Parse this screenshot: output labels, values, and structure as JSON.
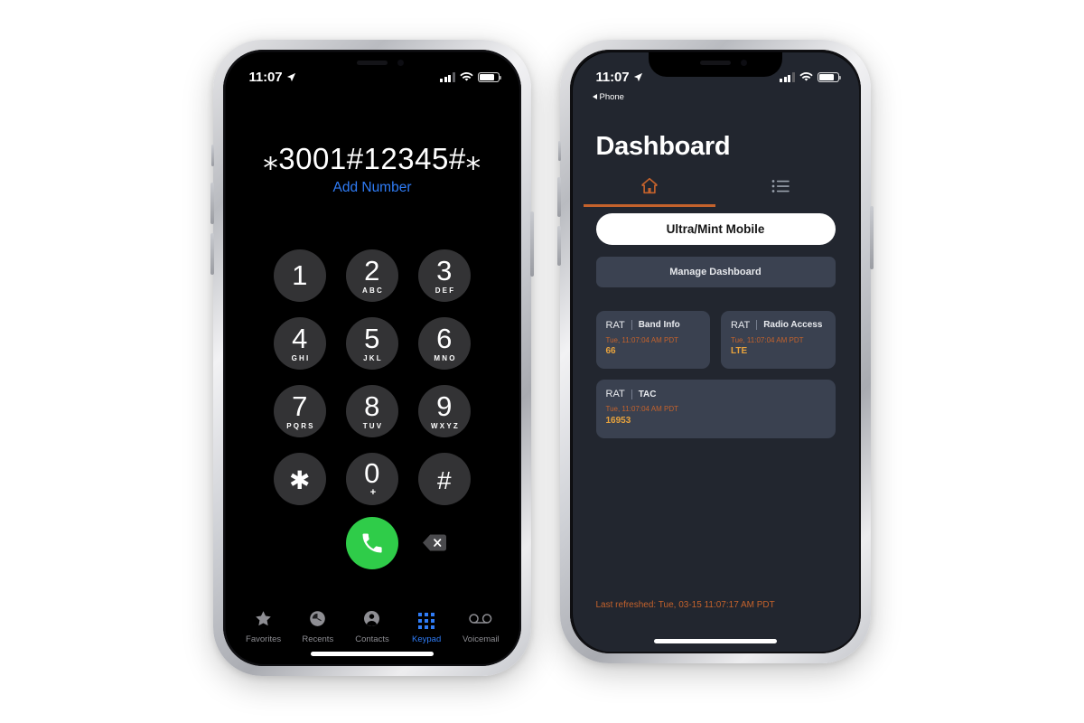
{
  "left_phone": {
    "status_bar": {
      "time": "11:07",
      "location_icon": "location-arrow-icon",
      "signal_icon": "cellular-signal-icon",
      "wifi_icon": "wifi-icon",
      "battery_icon": "battery-icon"
    },
    "dialer": {
      "number": "⁎3001#12345#⁎",
      "add_number_label": "Add Number",
      "keys": [
        {
          "digit": "1",
          "letters": ""
        },
        {
          "digit": "2",
          "letters": "ABC"
        },
        {
          "digit": "3",
          "letters": "DEF"
        },
        {
          "digit": "4",
          "letters": "GHI"
        },
        {
          "digit": "5",
          "letters": "JKL"
        },
        {
          "digit": "6",
          "letters": "MNO"
        },
        {
          "digit": "7",
          "letters": "PQRS"
        },
        {
          "digit": "8",
          "letters": "TUV"
        },
        {
          "digit": "9",
          "letters": "WXYZ"
        },
        {
          "digit": "✱",
          "letters": ""
        },
        {
          "digit": "0",
          "letters": "+"
        },
        {
          "digit": "#",
          "letters": ""
        }
      ],
      "call_button_icon": "phone-handset-icon",
      "delete_button_icon": "backspace-icon",
      "call_button_color": "#2fcc49"
    },
    "tabs": [
      {
        "label": "Favorites",
        "icon": "star-icon",
        "active": false
      },
      {
        "label": "Recents",
        "icon": "clock-icon",
        "active": false
      },
      {
        "label": "Contacts",
        "icon": "person-circle-icon",
        "active": false
      },
      {
        "label": "Keypad",
        "icon": "keypad-grid-icon",
        "active": true
      },
      {
        "label": "Voicemail",
        "icon": "voicemail-icon",
        "active": false
      }
    ],
    "active_tab_color": "#2f7cf6"
  },
  "right_phone": {
    "status_bar": {
      "time": "11:07",
      "location_icon": "location-arrow-icon",
      "signal_icon": "cellular-signal-icon",
      "wifi_icon": "wifi-icon",
      "battery_icon": "battery-icon"
    },
    "back_link": "Phone",
    "title": "Dashboard",
    "tabs": [
      {
        "icon": "home-icon",
        "active": true
      },
      {
        "icon": "list-icon",
        "active": false
      }
    ],
    "carrier_pill": "Ultra/Mint Mobile",
    "manage_button": "Manage Dashboard",
    "cards": [
      {
        "group": "RAT",
        "title": "Band Info",
        "timestamp": "Tue, 11:07:04 AM PDT",
        "value": "66",
        "size": "half"
      },
      {
        "group": "RAT",
        "title": "Radio Access",
        "timestamp": "Tue, 11:07:04 AM PDT",
        "value": "LTE",
        "size": "half"
      },
      {
        "group": "RAT",
        "title": "TAC",
        "timestamp": "Tue, 11:07:04 AM PDT",
        "value": "16953",
        "size": "full"
      }
    ],
    "last_refreshed": "Last refreshed: Tue, 03-15 11:07:17 AM PDT",
    "accent_color": "#c4622c",
    "value_color": "#e8a33d",
    "background_color": "#22262f",
    "card_color": "#3a4150"
  }
}
